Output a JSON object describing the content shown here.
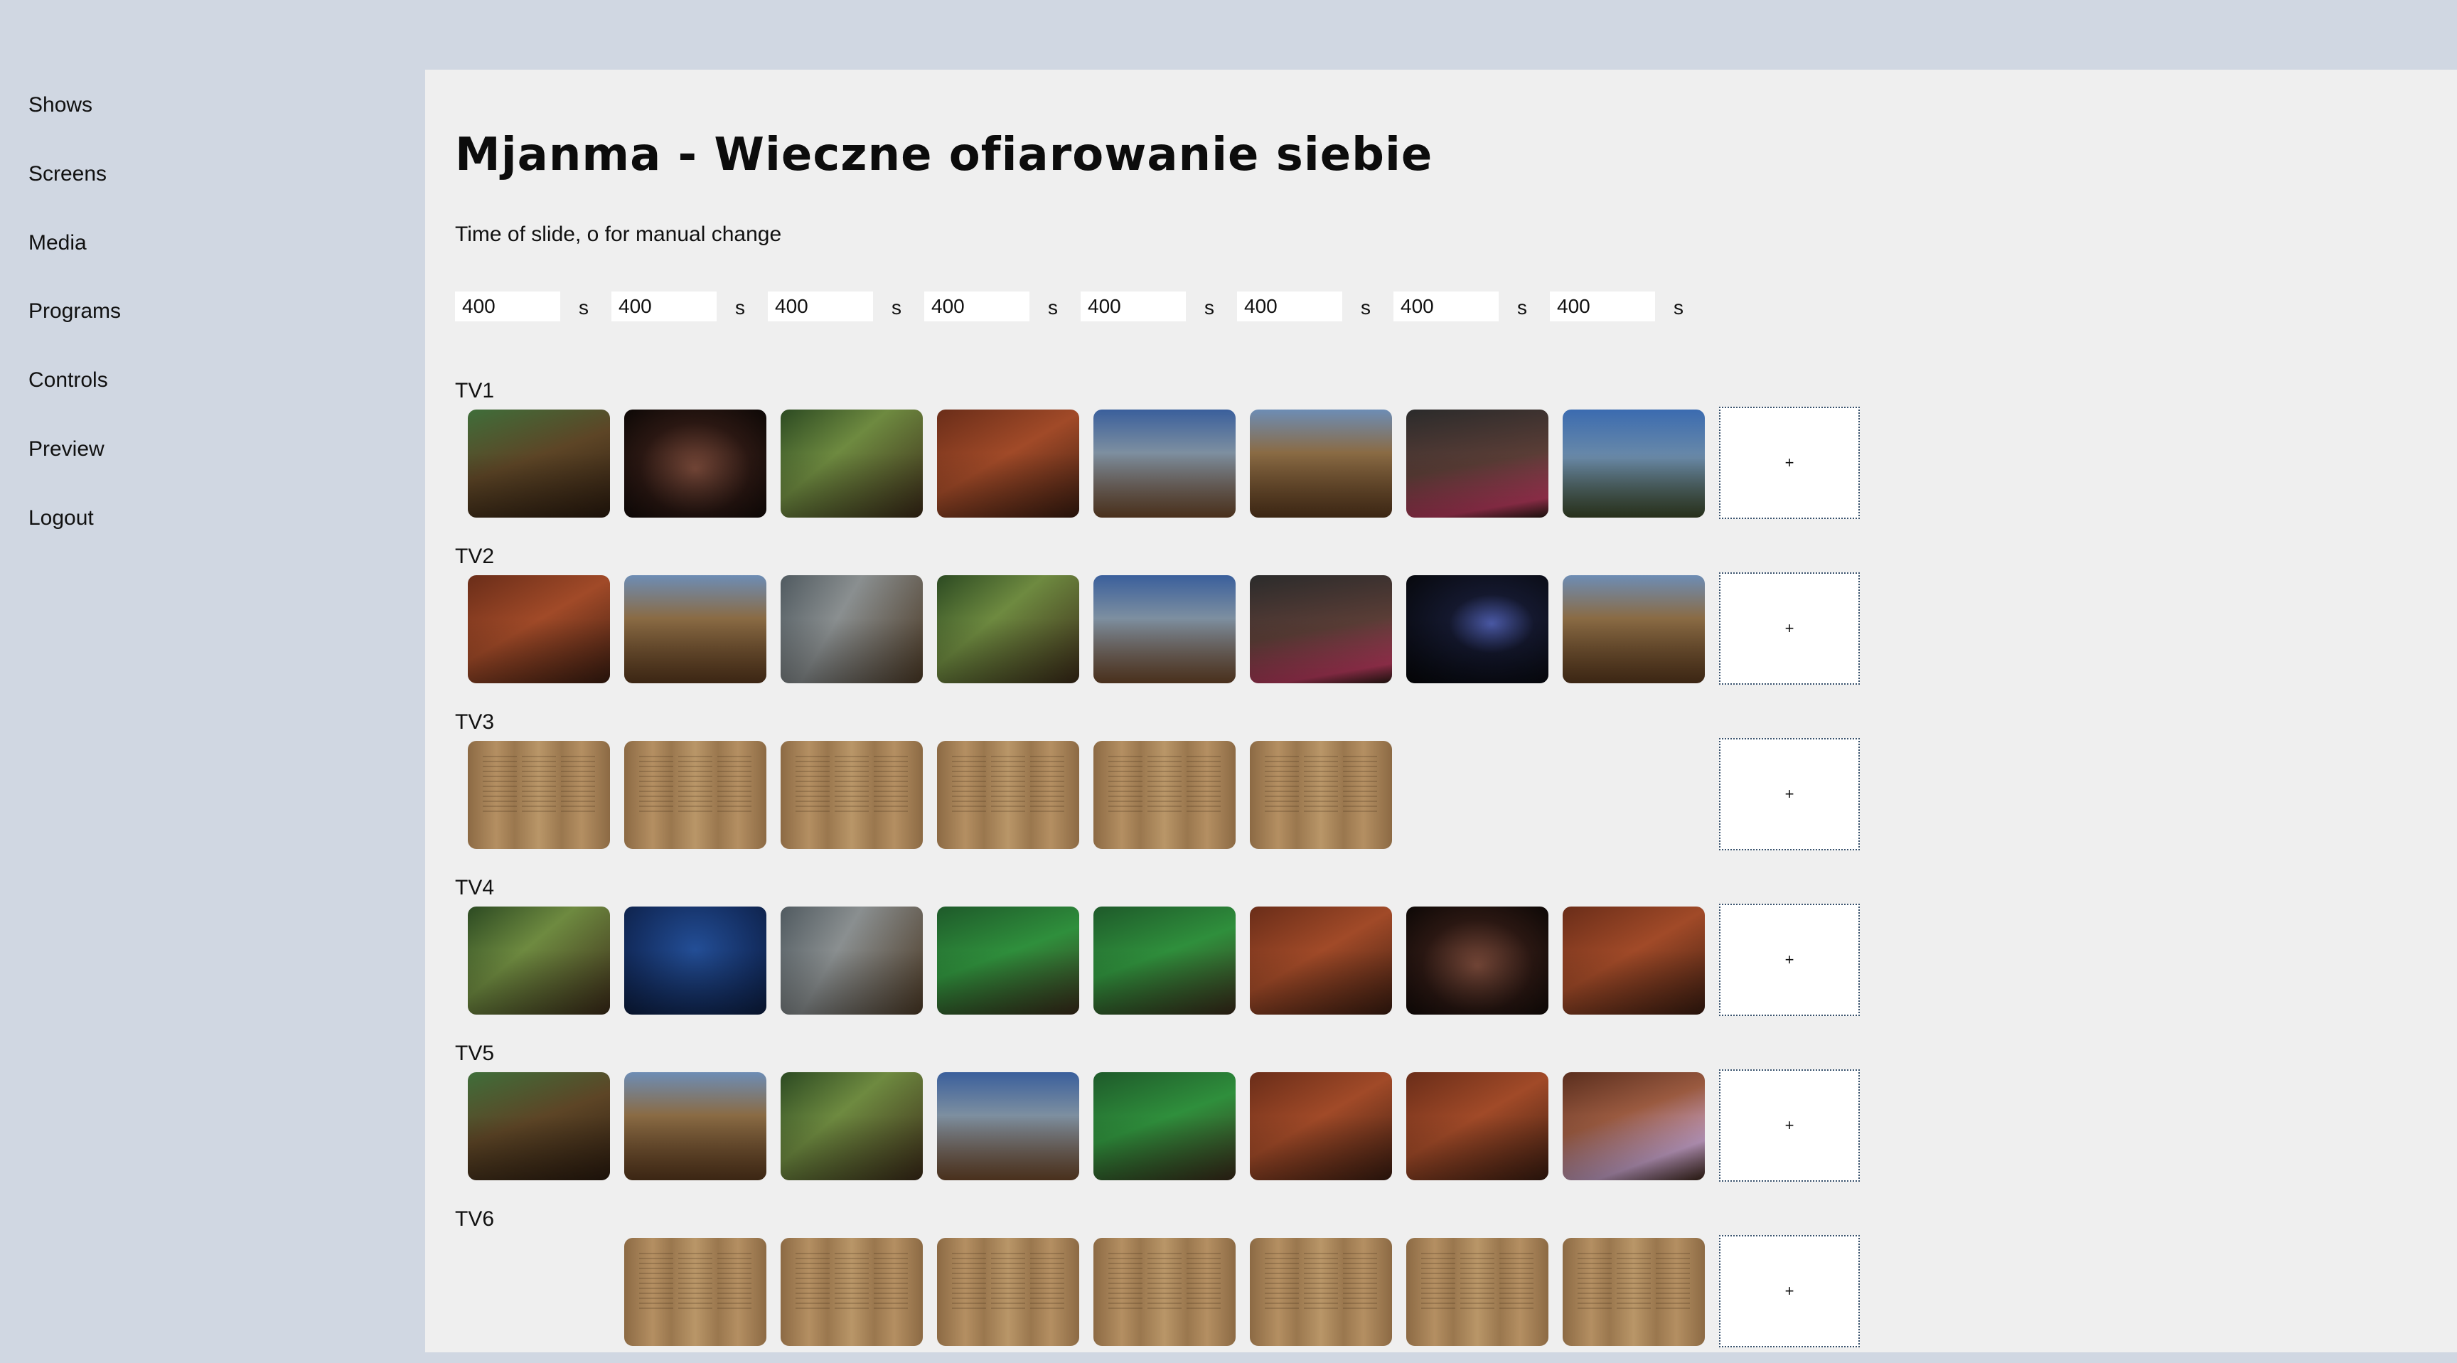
{
  "nav": [
    "Shows",
    "Screens",
    "Media",
    "Programs",
    "Controls",
    "Preview",
    "Logout"
  ],
  "show": {
    "title": "Mjanma - Wieczne ofiarowanie siebie",
    "slide_time_label": "Time of slide, o for manual change",
    "unit": "s",
    "slide_times": [
      "400",
      "400",
      "400",
      "400",
      "400",
      "400",
      "400",
      "400"
    ]
  },
  "add_label": "+",
  "tvs": [
    {
      "label": "TV1",
      "slots": [
        "photo-jungle",
        "photo-dark",
        "photo-forest",
        "photo-red",
        "photo-sky",
        "photo-dirt",
        "photo-crowd",
        "photo-cross"
      ]
    },
    {
      "label": "TV2",
      "slots": [
        "photo-red",
        "photo-dirt",
        "photo-metal",
        "photo-forest",
        "photo-sky",
        "photo-crowd",
        "photo-night",
        "photo-dirt"
      ]
    },
    {
      "label": "TV3",
      "slots": [
        "document-scan",
        "document-scan",
        "document-scan",
        "document-scan",
        "document-scan",
        "document-scan",
        "",
        ""
      ]
    },
    {
      "label": "TV4",
      "slots": [
        "photo-forest",
        "photo-blue",
        "photo-metal",
        "photo-green",
        "photo-green",
        "photo-red",
        "photo-dark",
        "photo-red"
      ]
    },
    {
      "label": "TV5",
      "slots": [
        "photo-jungle",
        "photo-dirt",
        "photo-forest",
        "photo-sky",
        "photo-green",
        "photo-red",
        "photo-red",
        "photo-purple"
      ]
    },
    {
      "label": "TV6",
      "slots": [
        "",
        "document-scan",
        "document-scan",
        "document-scan",
        "document-scan",
        "document-scan",
        "document-scan",
        "document-scan"
      ]
    }
  ]
}
